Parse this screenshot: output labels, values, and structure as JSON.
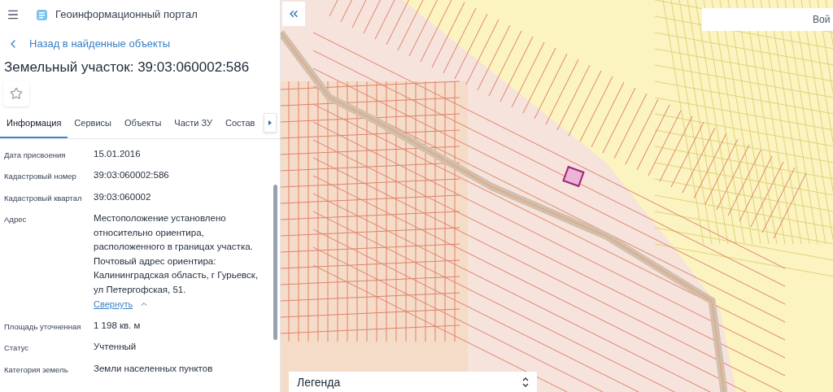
{
  "header": {
    "title": "Геоинформационный портал"
  },
  "back_link": "Назад в найденные объекты",
  "heading": "Земельный участок: 39:03:060002:586",
  "favorite": {
    "on": false
  },
  "tabs": [
    {
      "label": "Информация",
      "selected": true
    },
    {
      "label": "Сервисы",
      "selected": false
    },
    {
      "label": "Объекты",
      "selected": false
    },
    {
      "label": "Части ЗУ",
      "selected": false
    },
    {
      "label": "Состав",
      "selected": false
    }
  ],
  "fields": [
    {
      "label": "Дата присвоения",
      "value": "15.01.2016"
    },
    {
      "label": "Кадастровый номер",
      "value": "39:03:060002:586"
    },
    {
      "label": "Кадастровый квартал",
      "value": "39:03:060002"
    },
    {
      "label": "Адрес",
      "value": "Местоположение установлено относительно ориентира, расположенного в границах участка. Почтовый адрес ориентира: Калининградская область, г Гурьевск, ул Петергофская, 51.",
      "toggle": "Свернуть",
      "expanded": true
    },
    {
      "label": "Площадь уточненная",
      "value": "1 198 кв. м"
    },
    {
      "label": "Статус",
      "value": "Учтенный"
    },
    {
      "label": "Категория земель",
      "value": "Земли населенных пунктов"
    }
  ],
  "map": {
    "search": {
      "value": "Вой"
    },
    "legend": {
      "title": "Легенда"
    }
  }
}
